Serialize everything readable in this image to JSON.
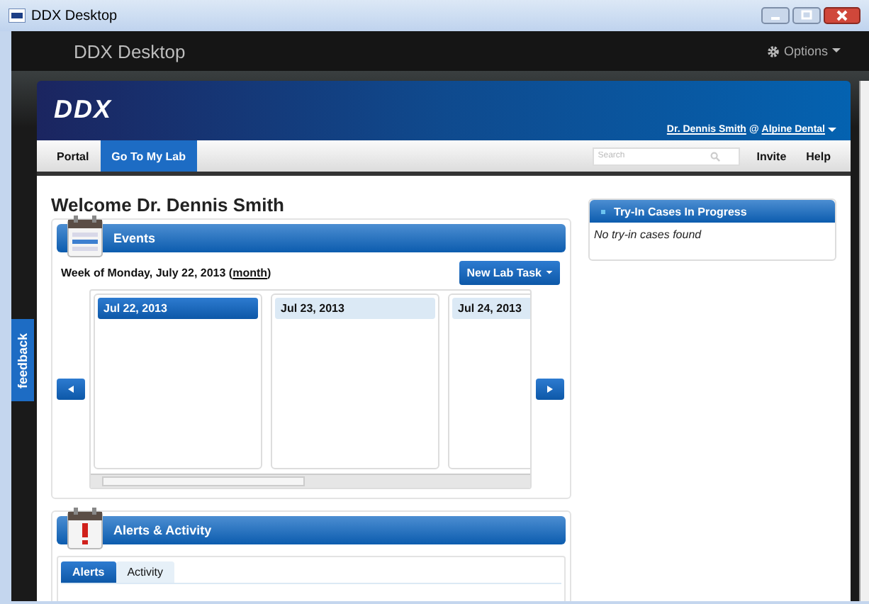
{
  "window": {
    "title": "DDX Desktop"
  },
  "app_bar": {
    "title": "DDX Desktop",
    "options": "Options"
  },
  "header": {
    "logo": "DDX",
    "user": "Dr. Dennis Smith",
    "separator": "@",
    "practice": "Alpine Dental"
  },
  "nav": {
    "tabs": [
      {
        "label": "Portal",
        "selected": false
      },
      {
        "label": "Go To My Lab",
        "selected": true
      }
    ],
    "search": {
      "placeholder": "Search"
    },
    "links": [
      "Invite",
      "Help"
    ]
  },
  "welcome": "Welcome Dr. Dennis Smith",
  "events": {
    "title": "Events",
    "week_prefix": "Week of Monday, July 22, 2013 (",
    "week_link": "month",
    "week_suffix": ")",
    "new_task": "New Lab Task",
    "days": [
      {
        "label": "Jul 22, 2013",
        "selected": true
      },
      {
        "label": "Jul 23, 2013",
        "selected": false
      },
      {
        "label": "Jul 24, 2013",
        "selected": false
      }
    ]
  },
  "alerts": {
    "title": "Alerts & Activity",
    "tabs": [
      {
        "label": "Alerts",
        "selected": true
      },
      {
        "label": "Activity",
        "selected": false
      }
    ]
  },
  "try_in": {
    "title": "Try-In Cases In Progress",
    "empty": "No try-in cases found"
  },
  "feedback": "feedback"
}
